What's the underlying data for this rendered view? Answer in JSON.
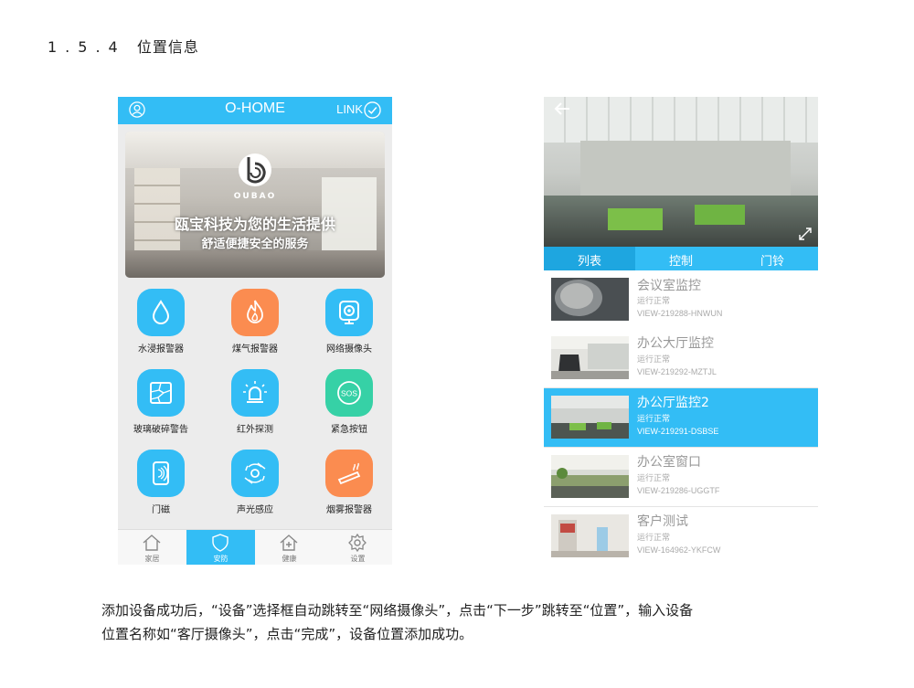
{
  "heading": {
    "number": "1.5.4",
    "title": "位置信息"
  },
  "left_app": {
    "header": {
      "title": "O-HOME",
      "link_label": "LINK"
    },
    "banner": {
      "brand": "OUBAO",
      "slogan1": "瓯宝科技为您的生活提供",
      "slogan2": "舒适便捷安全的服务"
    },
    "devices": [
      {
        "label": "水浸报警器",
        "icon": "water-drop-icon",
        "color": "#33bdf5"
      },
      {
        "label": "煤气报警器",
        "icon": "flame-icon",
        "color": "#fb8c50"
      },
      {
        "label": "网络摄像头",
        "icon": "camera-icon",
        "color": "#33bdf5"
      },
      {
        "label": "玻璃破碎警告",
        "icon": "broken-glass-icon",
        "color": "#33bdf5"
      },
      {
        "label": "红外探测",
        "icon": "infrared-alarm-icon",
        "color": "#33bdf5"
      },
      {
        "label": "紧急按钮",
        "icon": "sos-icon",
        "color": "#36d1a6"
      },
      {
        "label": "门磁",
        "icon": "door-sensor-icon",
        "color": "#33bdf5"
      },
      {
        "label": "声光感应",
        "icon": "sound-light-icon",
        "color": "#33bdf5"
      },
      {
        "label": "烟雾报警器",
        "icon": "smoke-icon",
        "color": "#fb8c50"
      }
    ],
    "tabs": [
      {
        "label": "家居",
        "icon": "home-icon"
      },
      {
        "label": "安防",
        "icon": "shield-icon",
        "active": true
      },
      {
        "label": "健康",
        "icon": "health-icon"
      },
      {
        "label": "设置",
        "icon": "gear-icon"
      }
    ]
  },
  "right_app": {
    "segments": [
      {
        "label": "列表",
        "active": true
      },
      {
        "label": "控制"
      },
      {
        "label": "门铃"
      }
    ],
    "cameras": [
      {
        "name": "会议室监控",
        "status": "运行正常",
        "id": "VIEW-219288-HNWUN"
      },
      {
        "name": "办公大厅监控",
        "status": "运行正常",
        "id": "VIEW-219292-MZTJL"
      },
      {
        "name": "办公厅监控2",
        "status": "运行正常",
        "id": "VIEW-219291-DSBSE",
        "selected": true
      },
      {
        "name": "办公室窗口",
        "status": "运行正常",
        "id": "VIEW-219286-UGGTF"
      },
      {
        "name": "客户测试",
        "status": "运行正常",
        "id": "VIEW-164962-YKFCW"
      }
    ]
  },
  "description": {
    "line1": "添加设备成功后，“设备”选择框自动跳转至“网络摄像头”，点击“下一步”跳转至“位置”，输入设备",
    "line2": "位置名称如“客厅摄像头”，点击“完成”，设备位置添加成功。"
  },
  "colors": {
    "accent": "#33bdf5",
    "accent_dark": "#1ea6e0",
    "orange": "#fb8c50",
    "green": "#36d1a6"
  }
}
